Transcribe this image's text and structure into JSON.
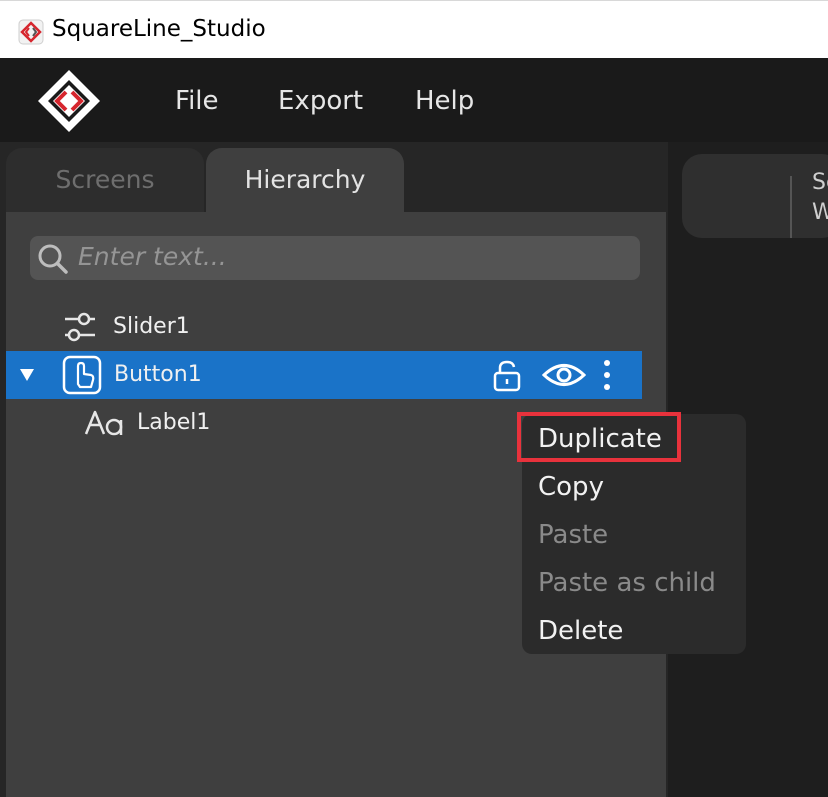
{
  "window": {
    "title": "SquareLine_Studio"
  },
  "menu": {
    "file": "File",
    "export": "Export",
    "help": "Help"
  },
  "tabs": {
    "screens": "Screens",
    "hierarchy": "Hierarchy"
  },
  "search": {
    "placeholder": "Enter text..."
  },
  "tree": {
    "slider": "Slider1",
    "button": "Button1",
    "label": "Label1"
  },
  "context_menu": {
    "duplicate": "Duplicate",
    "copy": "Copy",
    "paste": "Paste",
    "paste_as_child": "Paste as child",
    "delete": "Delete"
  },
  "toolbar": {
    "line1": "Scr",
    "line2": "Wi"
  },
  "colors": {
    "selection": "#1a73c8",
    "highlight": "#e8323c",
    "brand_red": "#d6262e"
  },
  "icons": {
    "slider": "slider-icon",
    "button": "button-icon",
    "label": "label-aa-icon",
    "lock": "unlock-icon",
    "eye": "eye-icon",
    "more": "more-vertical-icon"
  }
}
